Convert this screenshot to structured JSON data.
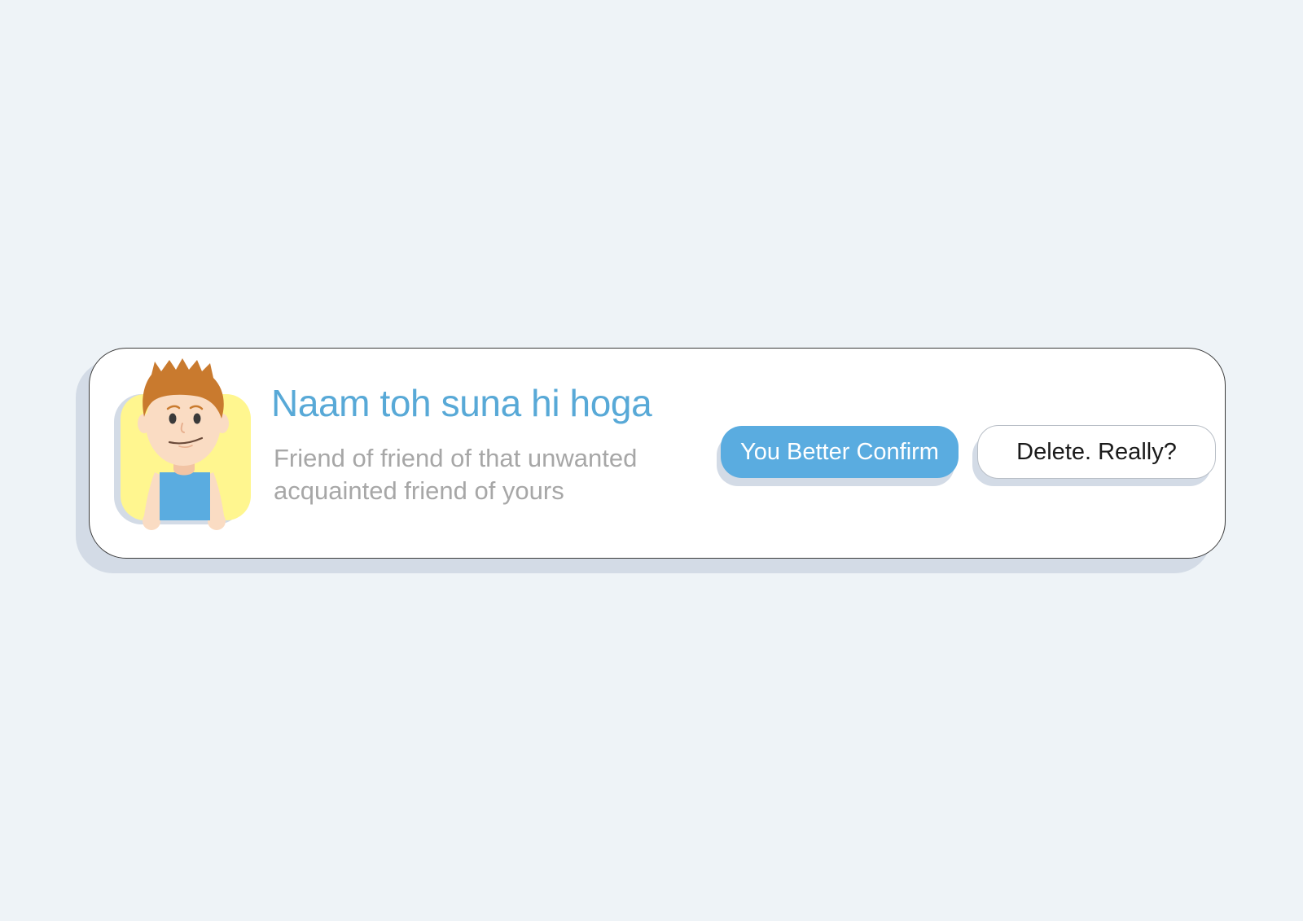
{
  "request": {
    "name": "Naam toh suna hi hoga",
    "description_lines": [
      "Friend of friend of that unwanted",
      "acquainted friend of yours"
    ],
    "avatar_icon": "cartoon-boy-avatar-icon",
    "confirm_label": "You Better Confirm",
    "delete_label": "Delete. Really?"
  },
  "colors": {
    "background": "#eef3f7",
    "card": "#ffffff",
    "shadow": "#d3dbe6",
    "name": "#58a9d7",
    "description": "#a7a7a7",
    "confirm_button": "#5aace0",
    "avatar_bg": "#fff68f",
    "hair": "#c97a2e",
    "shirt": "#5aace0",
    "skin": "#fadcc3"
  }
}
